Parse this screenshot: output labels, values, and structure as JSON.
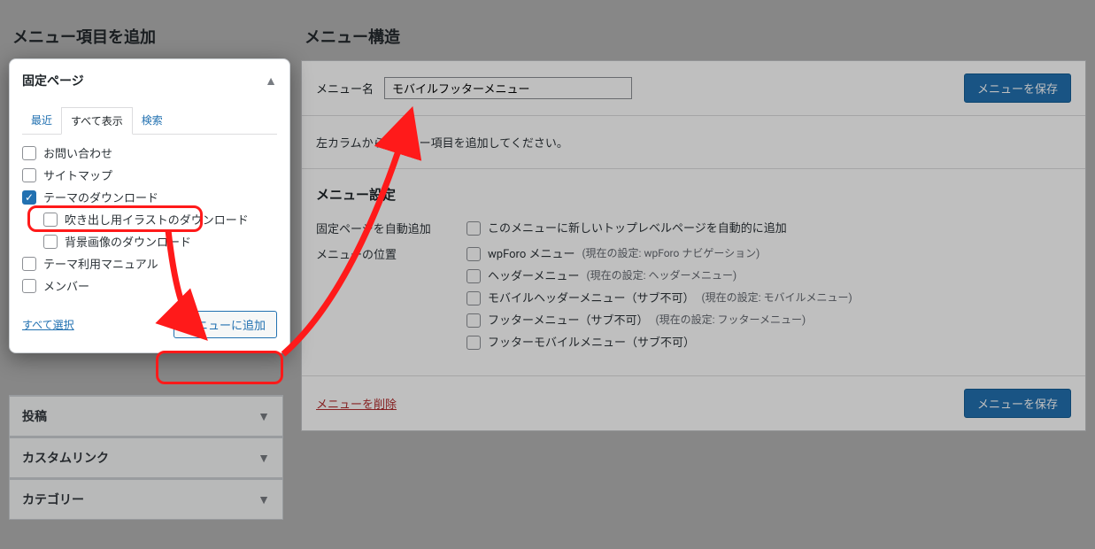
{
  "left": {
    "title": "メニュー項目を追加",
    "accordion": {
      "pages": "固定ページ",
      "posts": "投稿",
      "custom": "カスタムリンク",
      "categories": "カテゴリー"
    },
    "tabs": {
      "recent": "最近",
      "all": "すべて表示",
      "search": "検索"
    },
    "pages_list": [
      {
        "label": "お問い合わせ",
        "indent": false,
        "checked": false
      },
      {
        "label": "サイトマップ",
        "indent": false,
        "checked": false
      },
      {
        "label": "テーマのダウンロード",
        "indent": false,
        "checked": true
      },
      {
        "label": "吹き出し用イラストのダウンロード",
        "indent": true,
        "checked": false
      },
      {
        "label": "背景画像のダウンロード",
        "indent": true,
        "checked": false
      },
      {
        "label": "テーマ利用マニュアル",
        "indent": false,
        "checked": false
      },
      {
        "label": "メンバー",
        "indent": false,
        "checked": false
      }
    ],
    "select_all": "すべて選択",
    "add_button": "メニューに追加"
  },
  "right": {
    "title": "メニュー構造",
    "menu_name_label": "メニュー名",
    "menu_name_value": "モバイルフッターメニュー",
    "save_button": "メニューを保存",
    "empty_msg": "左カラムからメニュー項目を追加してください。",
    "settings_title": "メニュー設定",
    "auto_add": {
      "label": "固定ページを自動追加",
      "option": "このメニューに新しいトップレベルページを自動的に追加"
    },
    "locations_label": "メニューの位置",
    "locations": [
      {
        "name": "wpForo メニュー",
        "note": "(現在の設定: wpForo ナビゲーション)"
      },
      {
        "name": "ヘッダーメニュー",
        "note": "(現在の設定: ヘッダーメニュー)"
      },
      {
        "name": "モバイルヘッダーメニュー（サブ不可）",
        "note": "(現在の設定: モバイルメニュー)"
      },
      {
        "name": "フッターメニュー（サブ不可）",
        "note": "(現在の設定: フッターメニュー)"
      },
      {
        "name": "フッターモバイルメニュー（サブ不可）",
        "note": ""
      }
    ],
    "delete": "メニューを削除"
  }
}
